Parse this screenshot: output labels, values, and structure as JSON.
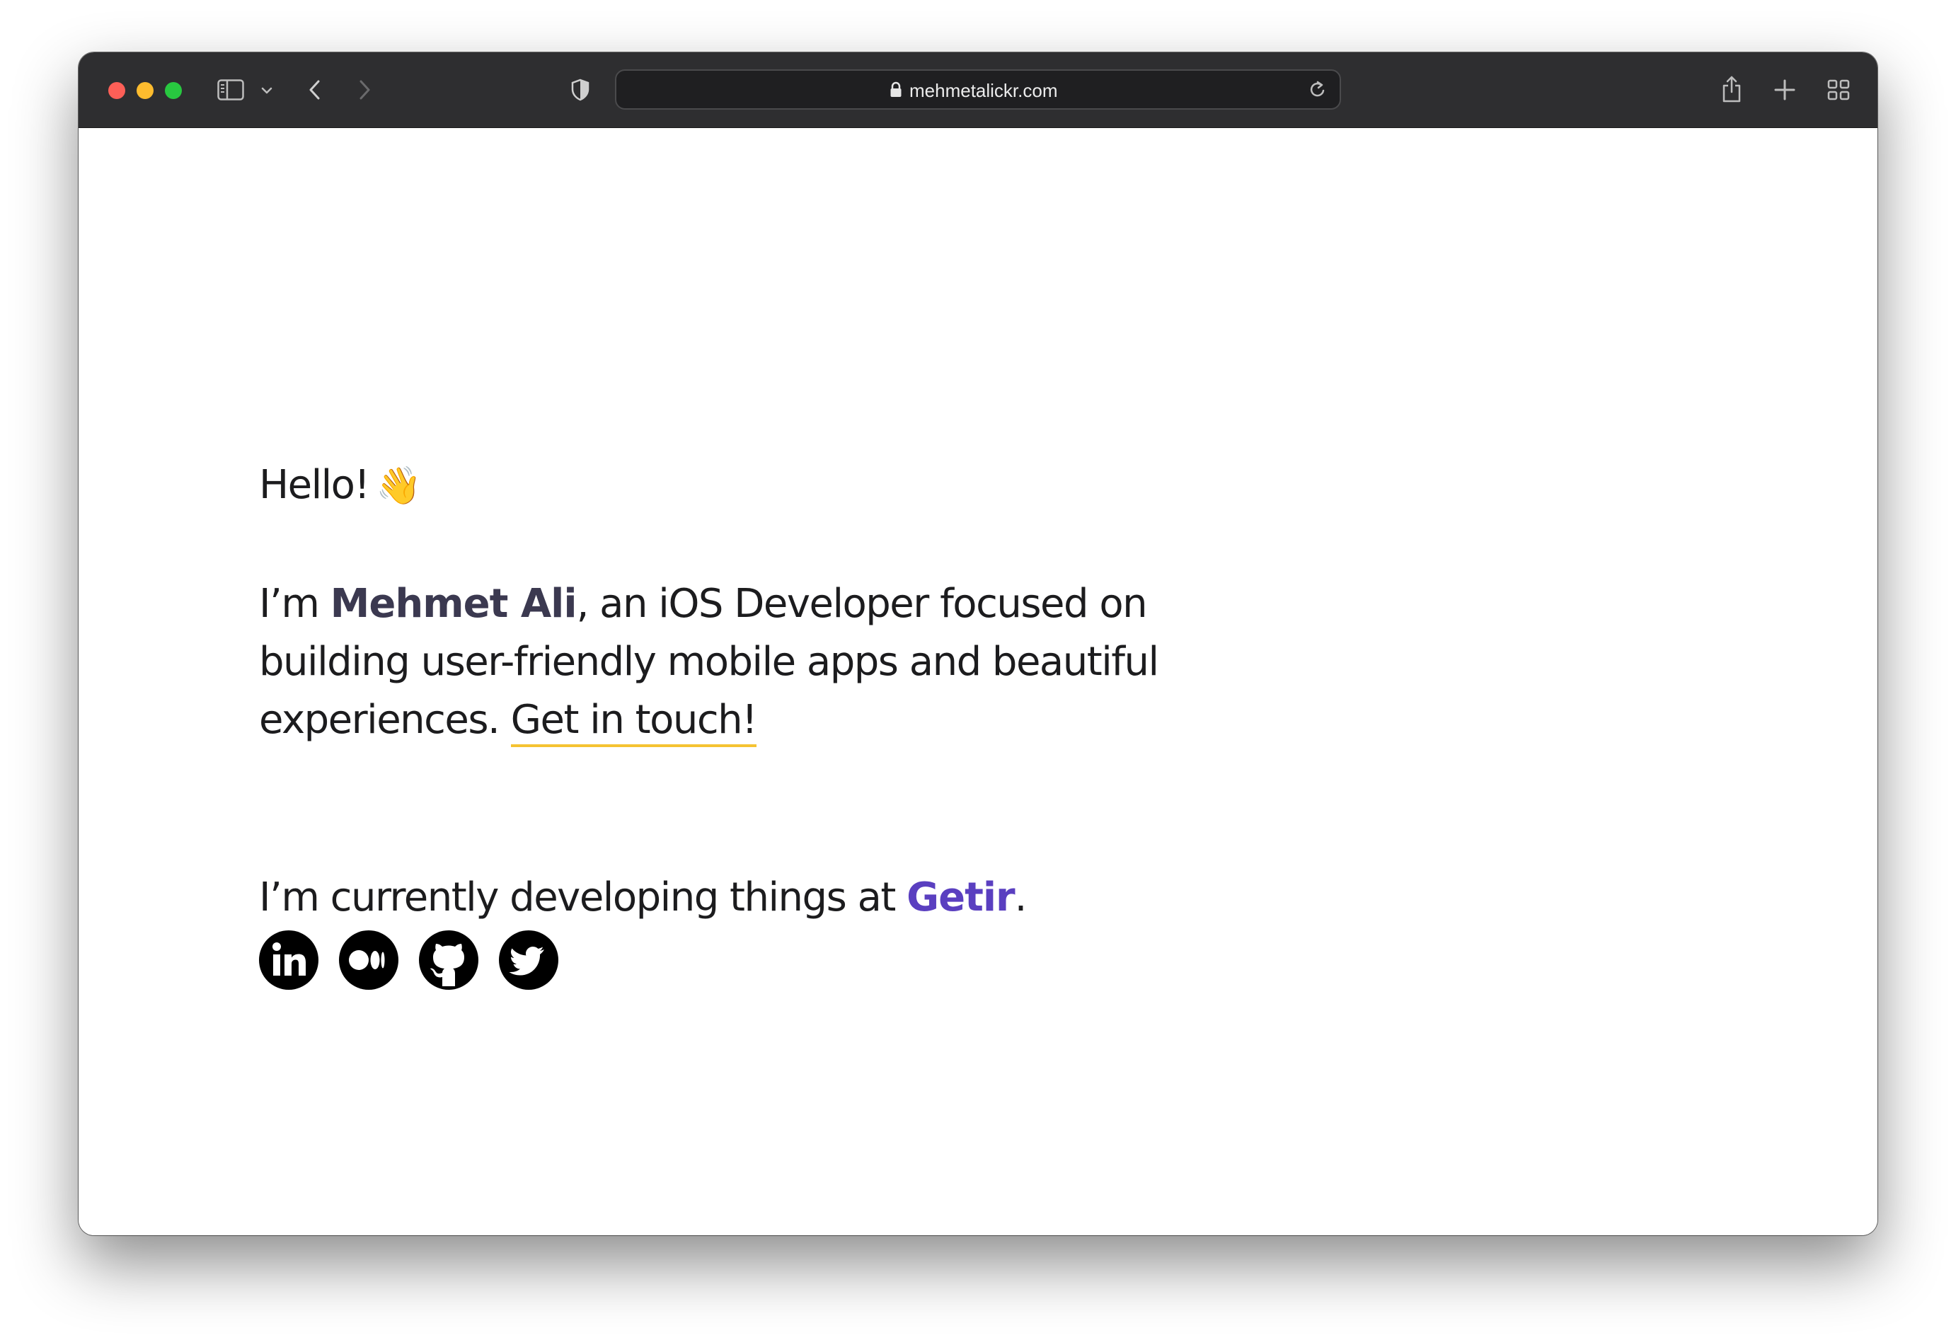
{
  "browser": {
    "url": "mehmetalickr.com",
    "icons": [
      "close-button",
      "minimize-button",
      "zoom-button",
      "sidebar-icon",
      "chevron-down-icon",
      "back-icon",
      "forward-icon",
      "shield-icon",
      "lock-icon",
      "reload-icon",
      "share-icon",
      "new-tab-icon",
      "tab-overview-icon"
    ]
  },
  "page": {
    "greeting": "Hello!",
    "greeting_emoji": "👋",
    "intro_prefix": "I’m ",
    "intro_name": "Mehmet Ali",
    "intro_line1_rest": ", an iOS Developer focused on",
    "intro_line2": "building user-friendly mobile apps and beautiful",
    "intro_line3_prefix": "experiences. ",
    "contact_link": "Get in touch!",
    "current_prefix": "I’m currently developing things at ",
    "company": "Getir",
    "current_suffix": "."
  },
  "social": [
    {
      "name": "LinkedIn",
      "icon": "linkedin-icon"
    },
    {
      "name": "Medium",
      "icon": "medium-icon"
    },
    {
      "name": "GitHub",
      "icon": "github-icon"
    },
    {
      "name": "Twitter",
      "icon": "twitter-icon"
    }
  ],
  "colors": {
    "toolbar": "#2e2e30",
    "text": "#1c1c1e",
    "name": "#3b3950",
    "link_underline": "#f5c332",
    "company_link": "#5a3fc0"
  }
}
